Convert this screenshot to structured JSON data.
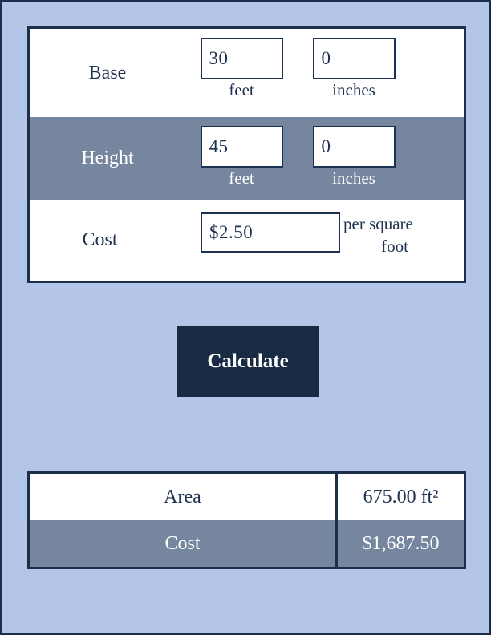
{
  "theme": {
    "background": "#b3c6e7",
    "border": "#1b2f4d",
    "slate_row": "#75869e",
    "button_bg": "#182a44",
    "text_dark": "#1f3150",
    "text_light": "#ffffff"
  },
  "input_form": {
    "rows": [
      {
        "label": "Base",
        "feet_value": "30",
        "feet_unit": "feet",
        "inches_value": "0",
        "inches_unit": "inches"
      },
      {
        "label": "Height",
        "feet_value": "45",
        "feet_unit": "feet",
        "inches_value": "0",
        "inches_unit": "inches"
      }
    ],
    "cost_row": {
      "label": "Cost",
      "value": "$2.50",
      "suffix_line1": "per square",
      "suffix_line2": "foot"
    }
  },
  "calculate_button": {
    "label": "Calculate"
  },
  "results": {
    "rows": [
      {
        "label": "Area",
        "value": "675.00 ft²"
      },
      {
        "label": "Cost",
        "value": "$1,687.50"
      }
    ]
  }
}
